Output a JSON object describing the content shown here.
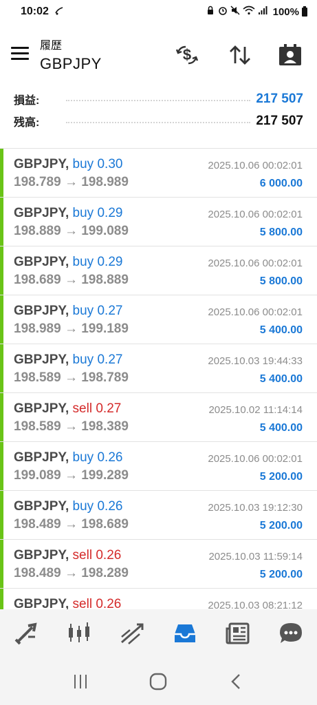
{
  "status_bar": {
    "time": "10:02",
    "battery": "100%"
  },
  "header": {
    "subtitle": "履歴",
    "title": "GBPJPY",
    "icons": [
      "menu-icon",
      "currency-exchange-icon",
      "sort-icon",
      "account-icon"
    ]
  },
  "summary": {
    "profit_label": "損益:",
    "profit_value": "217 507",
    "balance_label": "残高:",
    "balance_value": "217 507"
  },
  "colors": {
    "buy": "#1a78d6",
    "sell": "#d42a2a",
    "profit_bar": "#69c417",
    "accent": "#1a78d6"
  },
  "trades": [
    {
      "symbol": "GBPJPY,",
      "side": "buy",
      "volume": "0.30",
      "prices": "198.789 → 198.989",
      "time": "2025.10.06 00:02:01",
      "profit": "6 000.00"
    },
    {
      "symbol": "GBPJPY,",
      "side": "buy",
      "volume": "0.29",
      "prices": "198.889 → 199.089",
      "time": "2025.10.06 00:02:01",
      "profit": "5 800.00"
    },
    {
      "symbol": "GBPJPY,",
      "side": "buy",
      "volume": "0.29",
      "prices": "198.689 → 198.889",
      "time": "2025.10.06 00:02:01",
      "profit": "5 800.00"
    },
    {
      "symbol": "GBPJPY,",
      "side": "buy",
      "volume": "0.27",
      "prices": "198.989 → 199.189",
      "time": "2025.10.06 00:02:01",
      "profit": "5 400.00"
    },
    {
      "symbol": "GBPJPY,",
      "side": "buy",
      "volume": "0.27",
      "prices": "198.589 → 198.789",
      "time": "2025.10.03 19:44:33",
      "profit": "5 400.00"
    },
    {
      "symbol": "GBPJPY,",
      "side": "sell",
      "volume": "0.27",
      "prices": "198.589 → 198.389",
      "time": "2025.10.02 11:14:14",
      "profit": "5 400.00"
    },
    {
      "symbol": "GBPJPY,",
      "side": "buy",
      "volume": "0.26",
      "prices": "199.089 → 199.289",
      "time": "2025.10.06 00:02:01",
      "profit": "5 200.00"
    },
    {
      "symbol": "GBPJPY,",
      "side": "buy",
      "volume": "0.26",
      "prices": "198.489 → 198.689",
      "time": "2025.10.03 19:12:30",
      "profit": "5 200.00"
    },
    {
      "symbol": "GBPJPY,",
      "side": "sell",
      "volume": "0.26",
      "prices": "198.489 → 198.289",
      "time": "2025.10.03 11:59:14",
      "profit": "5 200.00"
    },
    {
      "symbol": "GBPJPY,",
      "side": "sell",
      "volume": "0.26",
      "prices": "",
      "time": "2025.10.03 08:21:12",
      "profit": ""
    }
  ],
  "bottom_nav": [
    "quotes-icon",
    "chart-icon",
    "trade-icon",
    "history-icon",
    "news-icon",
    "chat-icon"
  ],
  "system_nav": [
    "recent-apps-icon",
    "home-icon",
    "back-icon"
  ]
}
